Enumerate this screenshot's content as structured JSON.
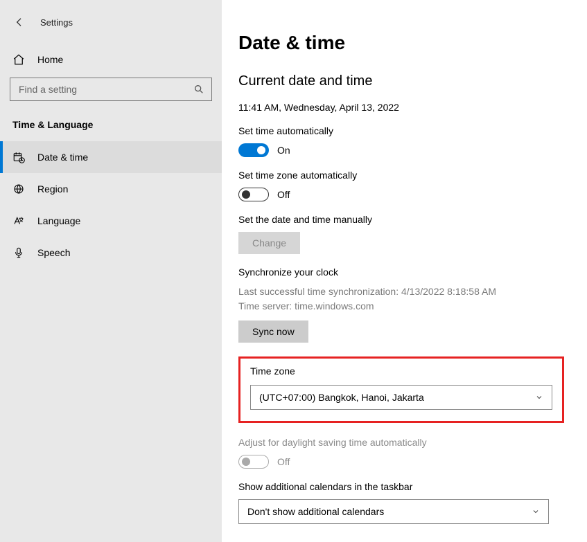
{
  "window": {
    "title": "Settings"
  },
  "sidebar": {
    "home_label": "Home",
    "search_placeholder": "Find a setting",
    "category": "Time & Language",
    "items": [
      {
        "label": "Date & time"
      },
      {
        "label": "Region"
      },
      {
        "label": "Language"
      },
      {
        "label": "Speech"
      }
    ]
  },
  "page": {
    "title": "Date & time",
    "current_heading": "Current date and time",
    "current_value": "11:41 AM, Wednesday, April 13, 2022",
    "set_time_auto_label": "Set time automatically",
    "set_time_auto_state": "On",
    "set_tz_auto_label": "Set time zone automatically",
    "set_tz_auto_state": "Off",
    "manual_label": "Set the date and time manually",
    "change_btn": "Change",
    "sync_heading": "Synchronize your clock",
    "sync_last": "Last successful time synchronization: 4/13/2022 8:18:58 AM",
    "sync_server": "Time server: time.windows.com",
    "sync_btn": "Sync now",
    "tz_label": "Time zone",
    "tz_value": "(UTC+07:00) Bangkok, Hanoi, Jakarta",
    "dst_label": "Adjust for daylight saving time automatically",
    "dst_state": "Off",
    "add_cal_label": "Show additional calendars in the taskbar",
    "add_cal_value": "Don't show additional calendars"
  }
}
